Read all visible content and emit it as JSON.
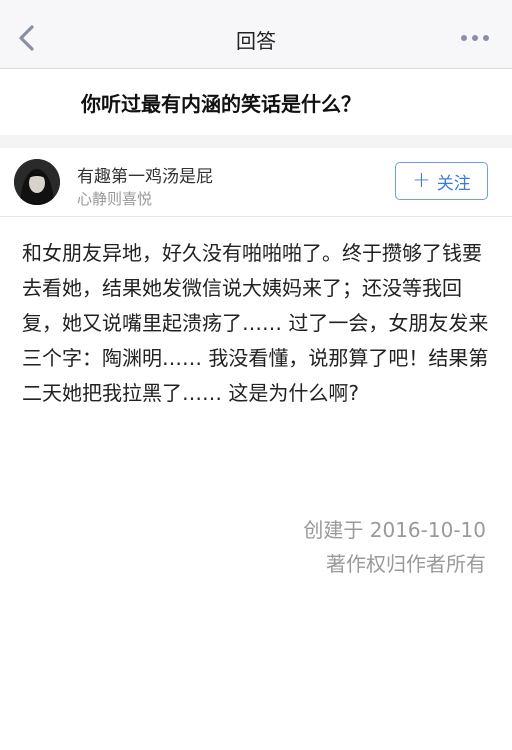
{
  "nav": {
    "title": "回答"
  },
  "question": {
    "title": "你听过最有内涵的笑话是什么？"
  },
  "answer": {
    "author_name": "有趣第一鸡汤是屁",
    "author_bio": "心静则喜悦",
    "follow_label": "关注",
    "paragraphs": [
      "和女朋友异地，好久没有啪啪啪了。终于攒够了钱要去看她，结果她发微信说大姨妈来了；还没等我回复，她又说嘴里起溃疡了…… 过了一会，女朋友发来三个字：陶渊明…… 我没看懂，说那算了吧！结果第二天她把我拉黑了…… 这是为什么啊?"
    ],
    "created": "创建于 2016-10-10",
    "copyright": "著作权归作者所有"
  },
  "colors": {
    "accent": "#3b7cdb",
    "muted": "#9a9a9a"
  },
  "icons": {
    "back": "chevron-left-icon",
    "more": "more-dots-icon",
    "follow": "plus-icon"
  }
}
